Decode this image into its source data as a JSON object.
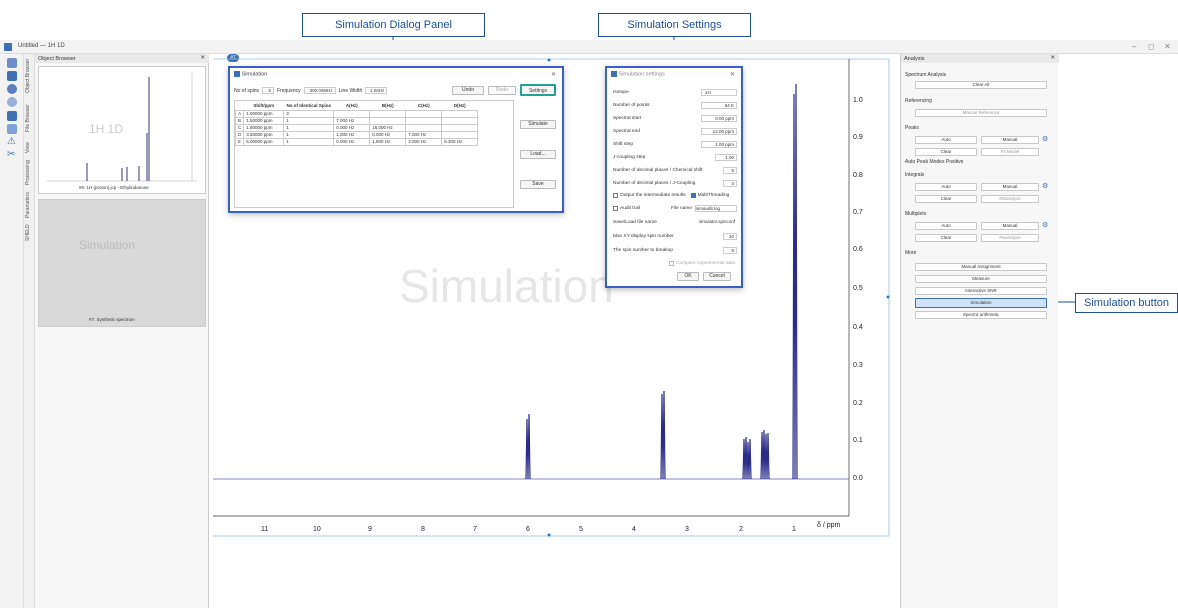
{
  "callouts": {
    "dialog_panel": "Simulation Dialog Panel",
    "settings": "Simulation Settings",
    "button": "Simulation button"
  },
  "window": {
    "title": "Untitled — 1H 1D"
  },
  "object_browser": {
    "title": "Object Browser",
    "thumb1_label": "1H 1D",
    "thumb1_caption": "#6: 1H (proton).jcp - Ethylindanone",
    "thumb2_label": "Simulation",
    "thumb2_caption": "#7: Synthetic spectrum"
  },
  "vtabs": [
    "Object Browser",
    "File Browser",
    "View",
    "Processing",
    "Parameters",
    "SHELD"
  ],
  "plot": {
    "watermark": "Simulation",
    "x_unit": "δ / ppm",
    "x_ticks": [
      "11",
      "10",
      "9",
      "8",
      "7",
      "6",
      "5",
      "4",
      "3",
      "2",
      "1"
    ],
    "y_ticks": [
      "1.0",
      "0.9",
      "0.8",
      "0.7",
      "0.6",
      "0.5",
      "0.4",
      "0.3",
      "0.2",
      "0.1",
      "0.0"
    ],
    "badge": "#7"
  },
  "sim_dialog": {
    "title": "Simulation",
    "num_spins_label": "No of spins",
    "num_spins": "5",
    "frequency_label": "Frequency",
    "frequency": "300.00MHz",
    "line_width_label": "Line Width",
    "line_width": "1.00Hz",
    "undo": "Undo",
    "redo": "Redo",
    "settings": "Settings",
    "simulate": "Simulate",
    "load": "Load...",
    "save": "Save",
    "headers": [
      "",
      "Shift/ppm",
      "No of Identical Spins",
      "A(Hz)",
      "B(Hz)",
      "C(Hz)",
      "D(Hz)"
    ],
    "rows": [
      [
        "A",
        "1.00000 ppm",
        "3",
        "",
        "",
        "",
        ""
      ],
      [
        "B",
        "1.50000 ppm",
        "1",
        "7.000 Hz",
        "",
        "",
        ""
      ],
      [
        "C",
        "1.80000 ppm",
        "1",
        "0.000 Hz",
        "16.000 Hz",
        "",
        ""
      ],
      [
        "D",
        "3.50000 ppm",
        "1",
        "1.000 Hz",
        "0.000 Hz",
        "7.000 Hz",
        ""
      ],
      [
        "E",
        "6.00000 ppm",
        "1",
        "0.000 Hz",
        "1.500 Hz",
        "2.000 Hz",
        "6.300 Hz"
      ]
    ]
  },
  "settings_dialog": {
    "title": "Simulation settings",
    "rows": [
      {
        "label": "Isotope",
        "value": "1H"
      },
      {
        "label": "Number of points",
        "value": "64 K"
      },
      {
        "label": "Spectral start",
        "value": "0.00 ppm"
      },
      {
        "label": "Spectral end",
        "value": "12.00 ppm"
      },
      {
        "label": "Shift step",
        "value": "1.00 ppm"
      },
      {
        "label": "J-coupling step",
        "value": "1.00"
      },
      {
        "label": "Number of decimal places / Chemical shift",
        "value": "5"
      },
      {
        "label": "Number of decimal places / J-Coupling",
        "value": "3"
      }
    ],
    "output_intermediate": "Output the intermediate results",
    "multithreading": "MultiThreading",
    "audit_trail": "Audit trail",
    "file_name_label": "File name",
    "file_name": "simaudit.log",
    "save_load_label": "Save/Load file name",
    "save_load_value": "simulator.spinconf",
    "max_xy_label": "Max XY display spin number",
    "max_xy_value": "10",
    "spin_breakup_label": "The spin number to breakup",
    "spin_breakup_value": "8",
    "compare": "Compare experimental data",
    "ok": "OK",
    "cancel": "Cancel"
  },
  "analysis": {
    "title": "Analysis",
    "spectrum_analysis": "Spectrum Analysis",
    "clear_all": "Clear All",
    "referencing": "Referencing",
    "manual_reference": "Manual Reference",
    "peaks": "Peaks",
    "auto": "Auto",
    "manual": "Manual",
    "clear": "Clear",
    "fit_model": "Fit Model",
    "auto_peak_modes": "Auto Peak Modes Positive",
    "integrals": "Integrals",
    "reanalyze": "Reanalyze",
    "multiplets": "Multiplets",
    "more": "More",
    "manual_assignment": "Manual Assignment",
    "measure": "Measure",
    "interactive_snr": "Interactive SNR",
    "simulation": "Simulation",
    "spectra_arithmetic": "Spectra arithmetic"
  }
}
